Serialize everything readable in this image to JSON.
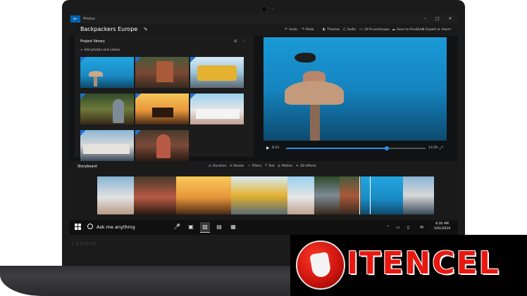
{
  "window": {
    "back_label": "←",
    "app_name": "Photos",
    "minimize": "–",
    "maximize": "□",
    "close": "✕"
  },
  "commandbar": {
    "project_title": "Backpackers Europe",
    "edit_icon": "pencil-icon",
    "items": [
      {
        "icon": "↶",
        "label": "Undo"
      },
      {
        "icon": "↷",
        "label": "Redo"
      },
      {
        "icon": "◐",
        "label": "Themes"
      },
      {
        "icon": "♫",
        "label": "Audio"
      },
      {
        "icon": "▭",
        "label": "16:9 Landscape"
      },
      {
        "icon": "☁",
        "label": "Save to OneDrive"
      },
      {
        "icon": "⇪",
        "label": "Export or share"
      }
    ],
    "more": "⋯"
  },
  "library": {
    "title": "Project library",
    "add_label": "+ Add photos and videos",
    "view_icons": [
      "⊞",
      "‹"
    ]
  },
  "playback": {
    "play_icon": "▶",
    "current_time": "8:23",
    "total_time": "13:29",
    "progress": 0.72,
    "fullscreen_icon": "⤢"
  },
  "storyboard": {
    "title": "Storyboard",
    "tools": [
      {
        "icon": "◷",
        "label": "Duration"
      },
      {
        "icon": "⟲",
        "label": "Resize"
      },
      {
        "icon": "✧",
        "label": "Filters"
      },
      {
        "icon": "T",
        "label": "Text"
      },
      {
        "icon": "◎",
        "label": "Motion"
      },
      {
        "icon": "✦",
        "label": "3D effects"
      }
    ]
  },
  "taskbar": {
    "search_text": "Ask me anything",
    "apps": [
      "🎤",
      "▣",
      "▨",
      "▤",
      "▦"
    ],
    "tray": [
      "⌃",
      "▭",
      "▯",
      "✉"
    ],
    "time": "6:30 AM",
    "date": "5/01/2019"
  },
  "bezel": {
    "brand": "Lenovo"
  },
  "banner": {
    "word": "ITENCEL"
  },
  "colors": {
    "accent": "#2b8fe8",
    "brand_red": "#e81810"
  }
}
